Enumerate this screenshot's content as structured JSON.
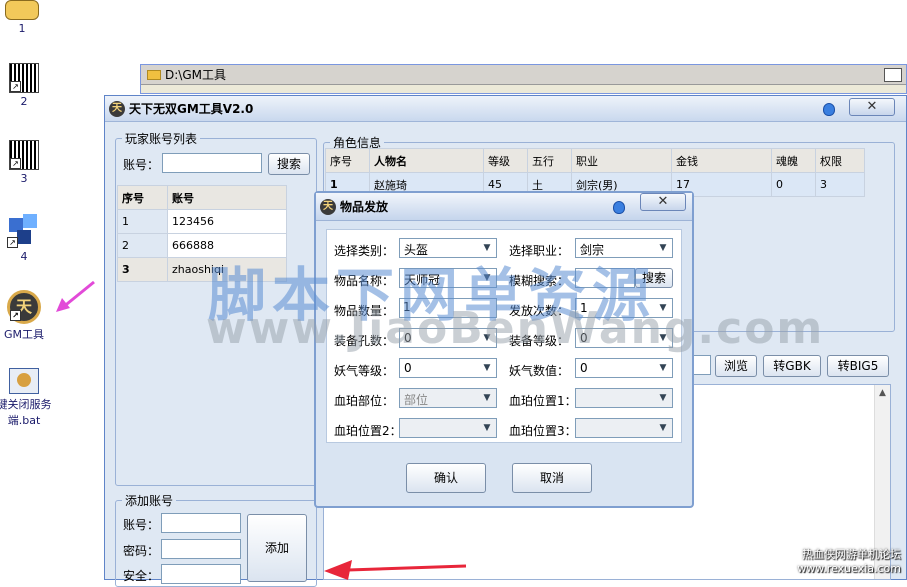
{
  "desktop": {
    "icons": [
      {
        "label": "1"
      },
      {
        "label": "2"
      },
      {
        "label": "3"
      },
      {
        "label": "4"
      },
      {
        "label": "GM工具"
      },
      {
        "label": "键关闭服务\n端.bat"
      }
    ]
  },
  "bg_window": {
    "path": "D:\\GM工具"
  },
  "main": {
    "title": "天下无双GM工具V2.0",
    "accounts": {
      "legend": "玩家账号列表",
      "account_label": "账号：",
      "search_button": "搜索",
      "columns": [
        "序号",
        "账号"
      ],
      "rows": [
        {
          "no": "1",
          "account": "123456"
        },
        {
          "no": "2",
          "account": "666888"
        },
        {
          "no": "3",
          "account": "zhaoshiqi"
        }
      ]
    },
    "add_account": {
      "legend": "添加账号",
      "account_label": "账号：",
      "password_label": "密码：",
      "security_label": "安全：",
      "add_button": "添加"
    },
    "role": {
      "legend": "角色信息",
      "columns": [
        "序号",
        "人物名",
        "等级",
        "五行",
        "职业",
        "金钱",
        "魂魄",
        "权限"
      ],
      "rows": [
        {
          "no": "1",
          "name": "赵施琦",
          "level": "45",
          "element": "土",
          "job": "剑宗(男)",
          "money": "17",
          "soul": "0",
          "perm": "3"
        }
      ]
    },
    "tools": {
      "browse_button": "浏览",
      "gbk_button": "转GBK",
      "big5_button": "转BIG5"
    }
  },
  "dialog": {
    "title": "物品发放",
    "fields": {
      "category_label": "选择类别：",
      "category_value": "头盔",
      "job_label": "选择职业：",
      "job_value": "剑宗",
      "item_name_label": "物品名称：",
      "item_name_value": "天师冠",
      "fuzzy_label": "模糊搜索：",
      "fuzzy_button": "搜索",
      "quantity_label": "物品数量：",
      "quantity_value": "1",
      "times_label": "发放次数：",
      "times_value": "1",
      "holes_label": "装备孔数：",
      "holes_value": "0",
      "equip_level_label": "装备等级：",
      "equip_level_value": "0",
      "aura_level_label": "妖气等级：",
      "aura_level_value": "0",
      "aura_value_label": "妖气数值：",
      "aura_value_value": "0",
      "blood_part_label": "血珀部位：",
      "blood_part_value": "部位",
      "blood_pos1_label": "血珀位置1：",
      "blood_pos1_value": "",
      "blood_pos2_label": "血珀位置2：",
      "blood_pos2_value": "",
      "blood_pos3_label": "血珀位置3：",
      "blood_pos3_value": ""
    },
    "ok_button": "确认",
    "cancel_button": "取消"
  },
  "watermark": {
    "line1": "脚本下网单资源",
    "line2": "www.JiaoBenWang.com"
  },
  "corner": {
    "line1": "热血侠网游单机论坛",
    "line2": "www.rexuexia.com"
  },
  "colors": {
    "arrow_pink": "#e24ad8",
    "arrow_red": "#e8263a"
  }
}
